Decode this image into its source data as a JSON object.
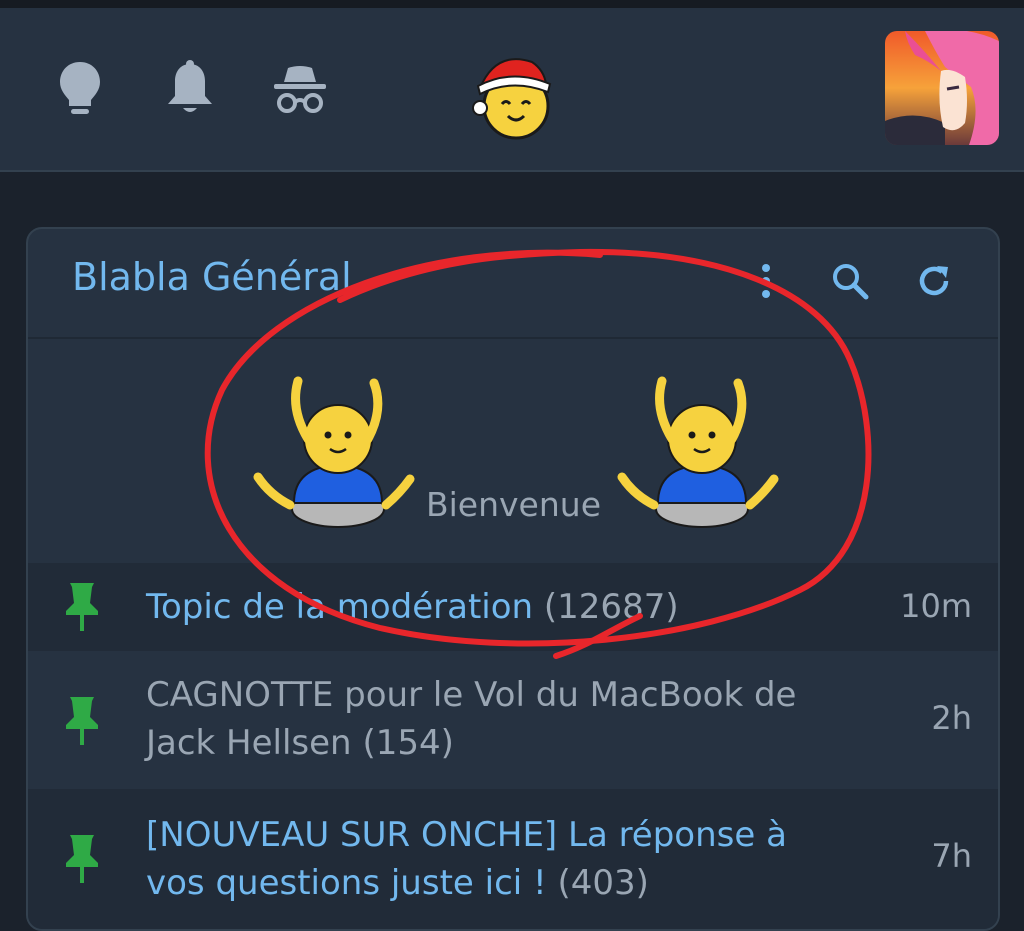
{
  "header": {
    "icons": [
      "lightbulb-icon",
      "bell-icon",
      "incognito-icon"
    ],
    "logo": "santa-hat-smiley-logo",
    "avatar": "anime-avatar"
  },
  "forum": {
    "title": "Blabla Général",
    "actions": [
      "more-vertical-icon",
      "search-icon",
      "refresh-icon"
    ],
    "banner_text": "Bienvenue",
    "topics": [
      {
        "title": "Topic de la modération",
        "count": "(12687)",
        "time": "10m",
        "pinned": true,
        "color": "#72b8ee"
      },
      {
        "title": "CAGNOTTE pour le Vol du MacBook de Jack Hellsen",
        "count": "(154)",
        "time": "2h",
        "pinned": true,
        "color": "#9aa6b3"
      },
      {
        "title": "[NOUVEAU SUR ONCHE] La réponse à vos questions juste ici !",
        "count": "(403)",
        "time": "7h",
        "pinned": true,
        "color": "#72b8ee"
      }
    ]
  },
  "colors": {
    "background": "#1b222c",
    "panel": "#263241",
    "accent": "#72b8ee",
    "muted": "#9aa6b3",
    "pin": "#2faa46",
    "annotation": "#e8262b"
  }
}
